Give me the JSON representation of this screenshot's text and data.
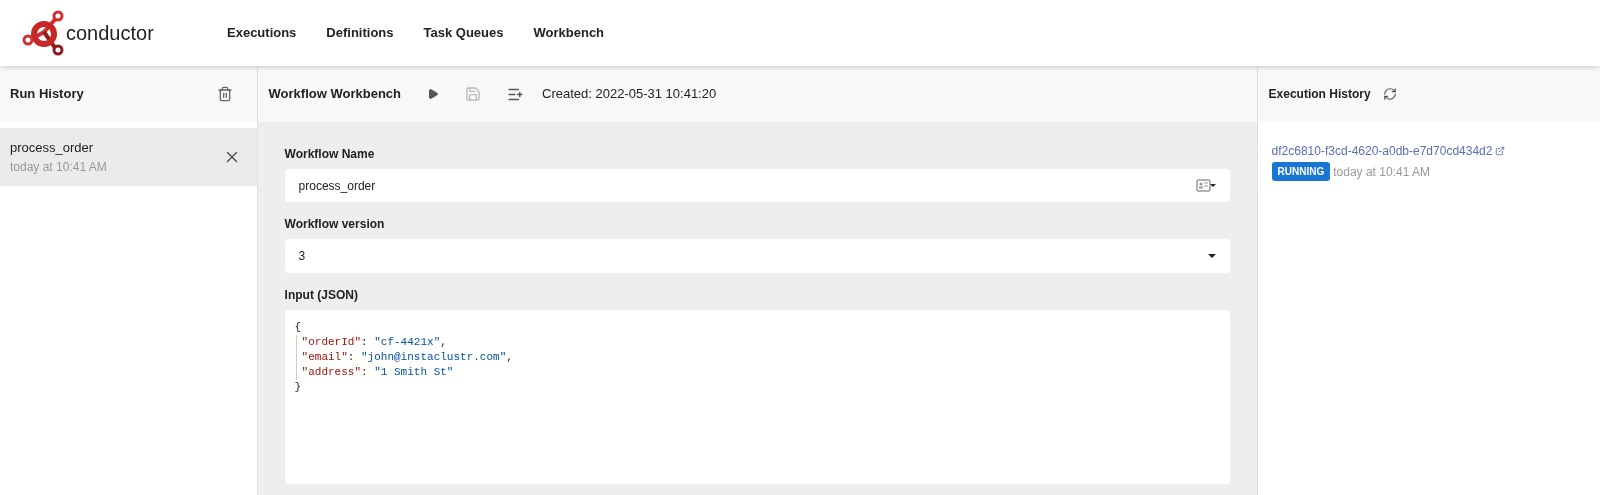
{
  "nav": {
    "logo_text": "conductor",
    "items": [
      {
        "label": "Executions",
        "selected": false
      },
      {
        "label": "Definitions",
        "selected": false
      },
      {
        "label": "Task Queues",
        "selected": false
      },
      {
        "label": "Workbench",
        "selected": false
      }
    ]
  },
  "run_history": {
    "title": "Run History",
    "items": [
      {
        "name": "process_order",
        "time": "today at 10:41 AM",
        "selected": true
      }
    ]
  },
  "workbench": {
    "title": "Workflow Workbench",
    "created": "Created: 2022-05-31 10:41:20",
    "name_label": "Workflow Name",
    "name_value": "process_order",
    "version_label": "Workflow version",
    "version_value": "3",
    "input_label": "Input (JSON)",
    "open_brace": "{",
    "close_brace": "}",
    "input_lines": [
      {
        "key": "\"orderId\"",
        "sep": ":",
        "value": "\"cf-4421x\"",
        "comma": ","
      },
      {
        "key": "\"email\"",
        "sep": ":",
        "value": "\"john@instaclustr.com\"",
        "comma": ","
      },
      {
        "key": "\"address\"",
        "sep": ":",
        "value": "\"1 Smith St\""
      }
    ]
  },
  "execution_history": {
    "title": "Execution History",
    "items": [
      {
        "id": "df2c6810-f3cd-4620-a0db-e7d70cd434d2",
        "status": "RUNNING",
        "color": "#1976d2",
        "time": "today at 10:41 AM"
      }
    ]
  }
}
